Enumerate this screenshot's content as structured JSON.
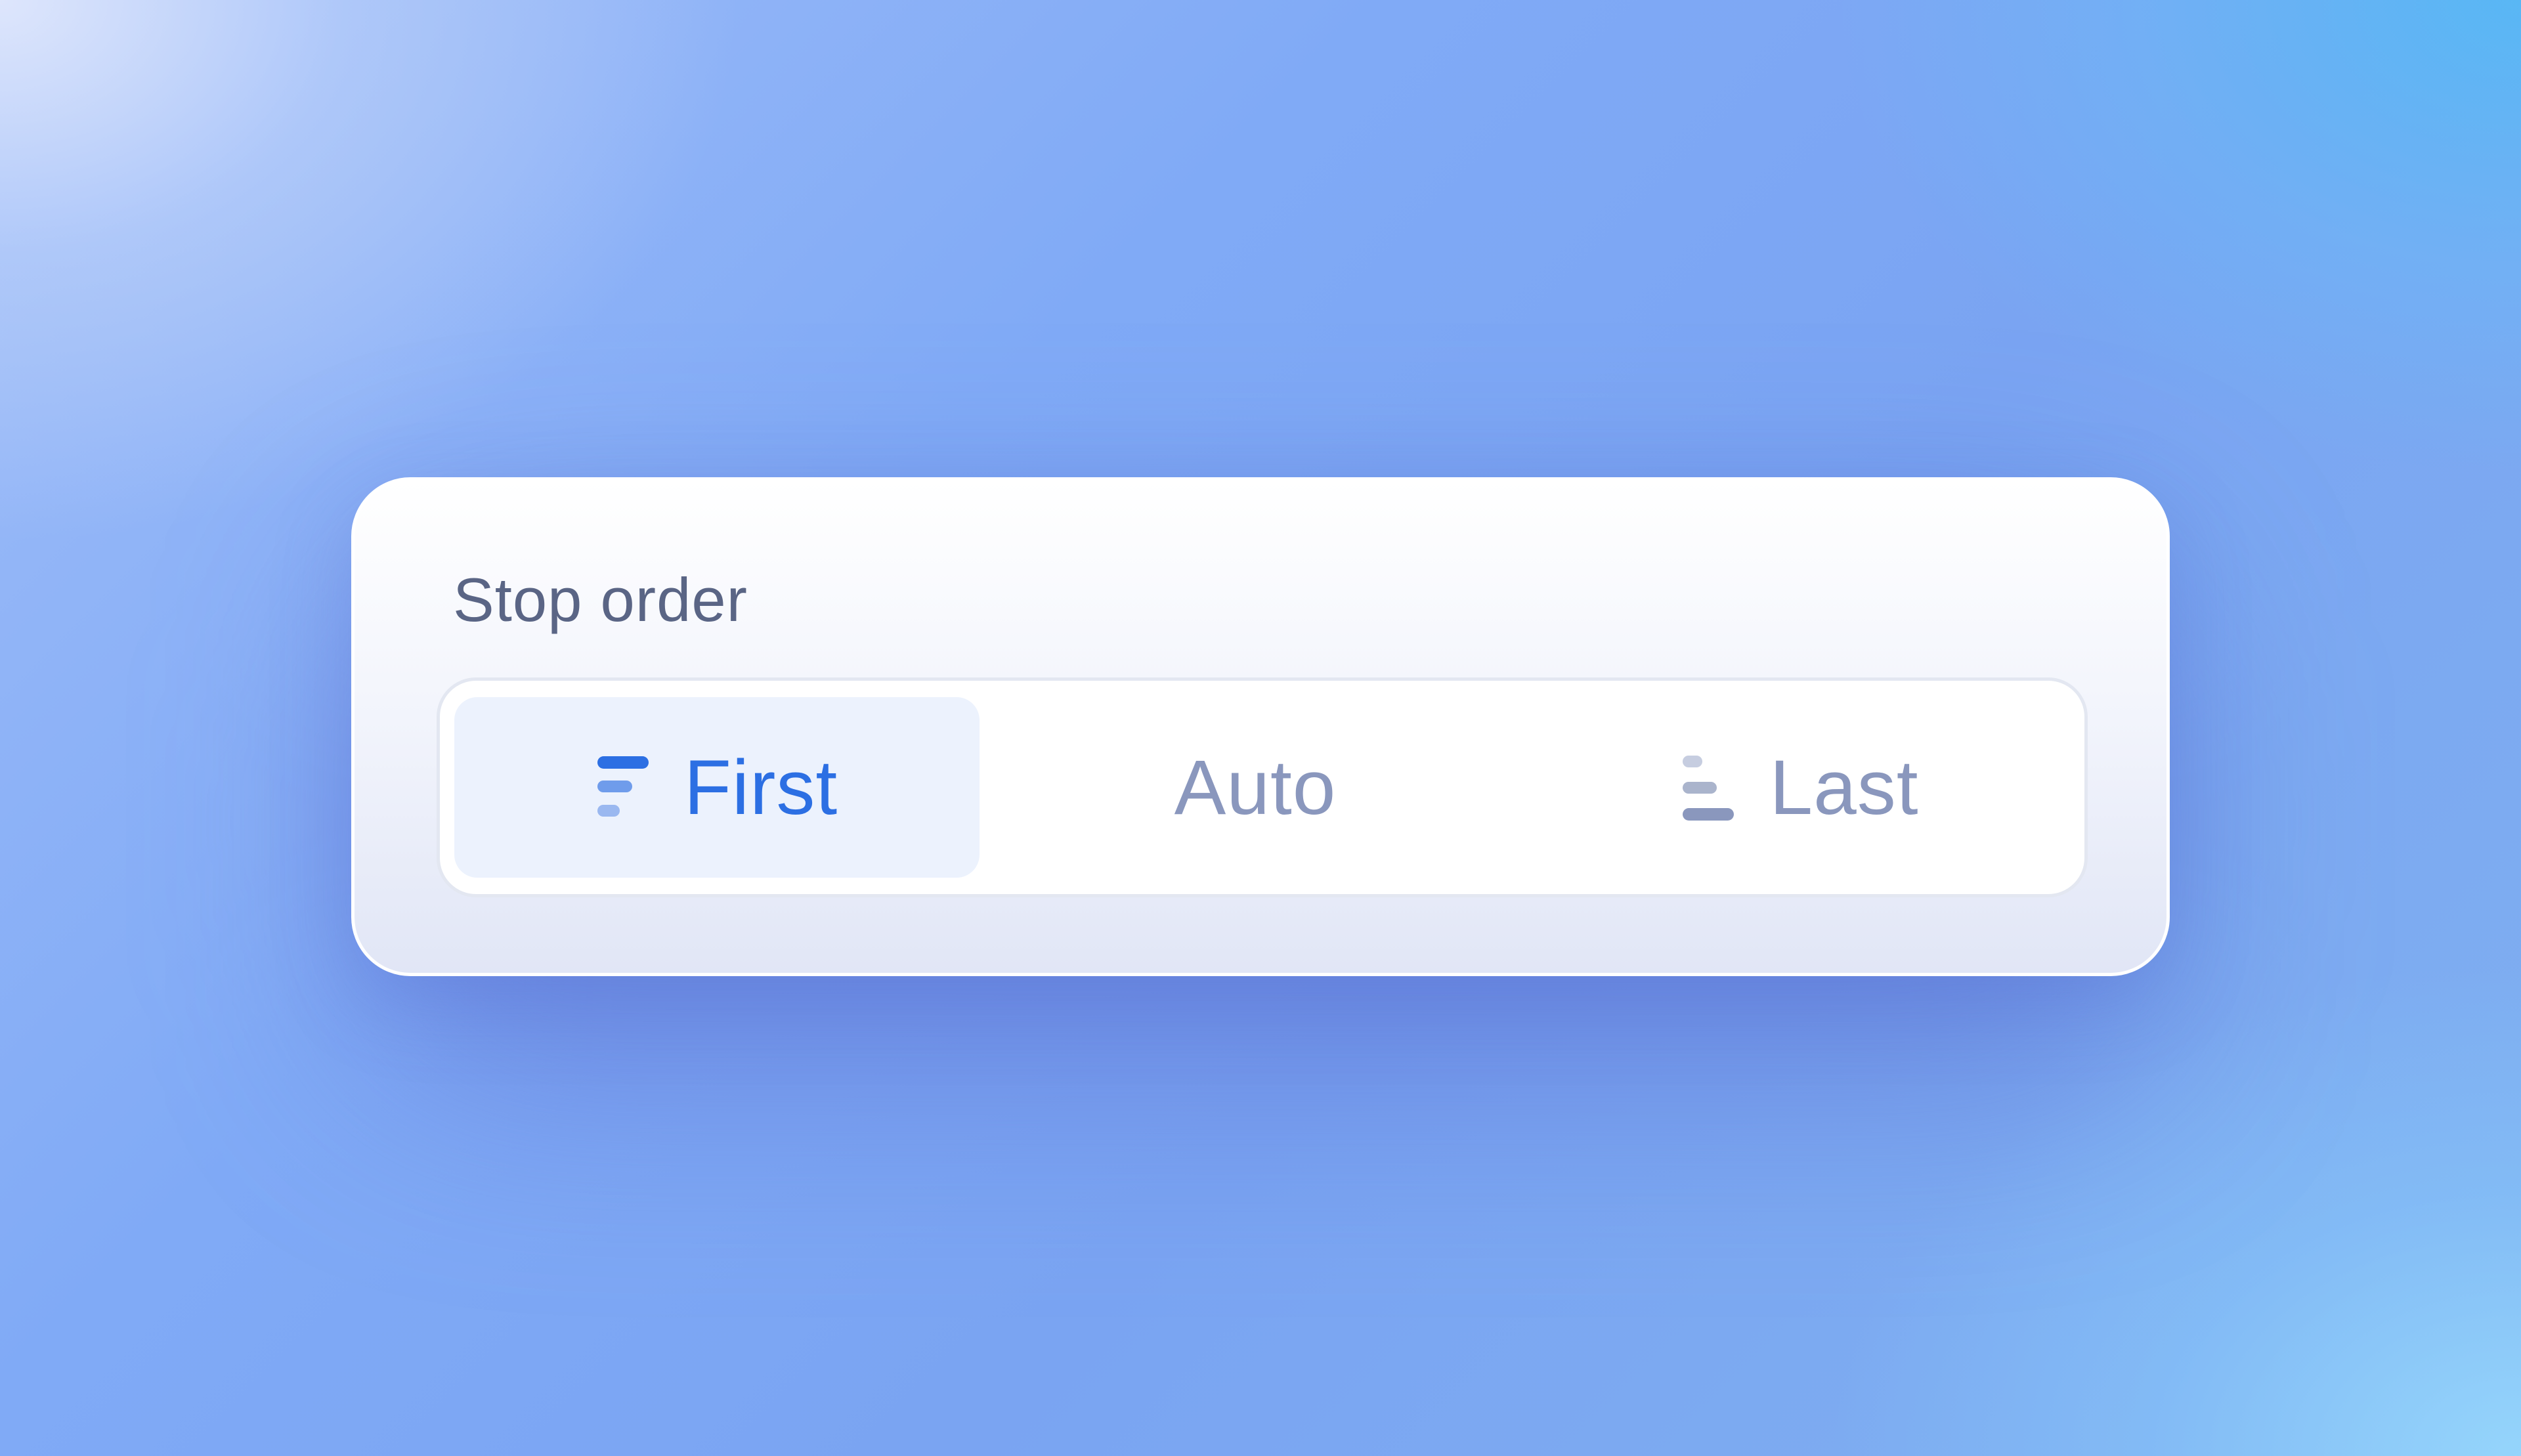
{
  "panel": {
    "title": "Stop order"
  },
  "segmented_control": {
    "selected": "First",
    "options": [
      {
        "label": "First",
        "icon": "align-top-icon"
      },
      {
        "label": "Auto",
        "icon": ""
      },
      {
        "label": "Last",
        "icon": "align-bottom-icon"
      }
    ]
  },
  "colors": {
    "selected_text": "#2c6fe3",
    "selected_background": "#ecf2fd",
    "unselected_text": "#8a97bd",
    "title_text": "#5a6585"
  }
}
